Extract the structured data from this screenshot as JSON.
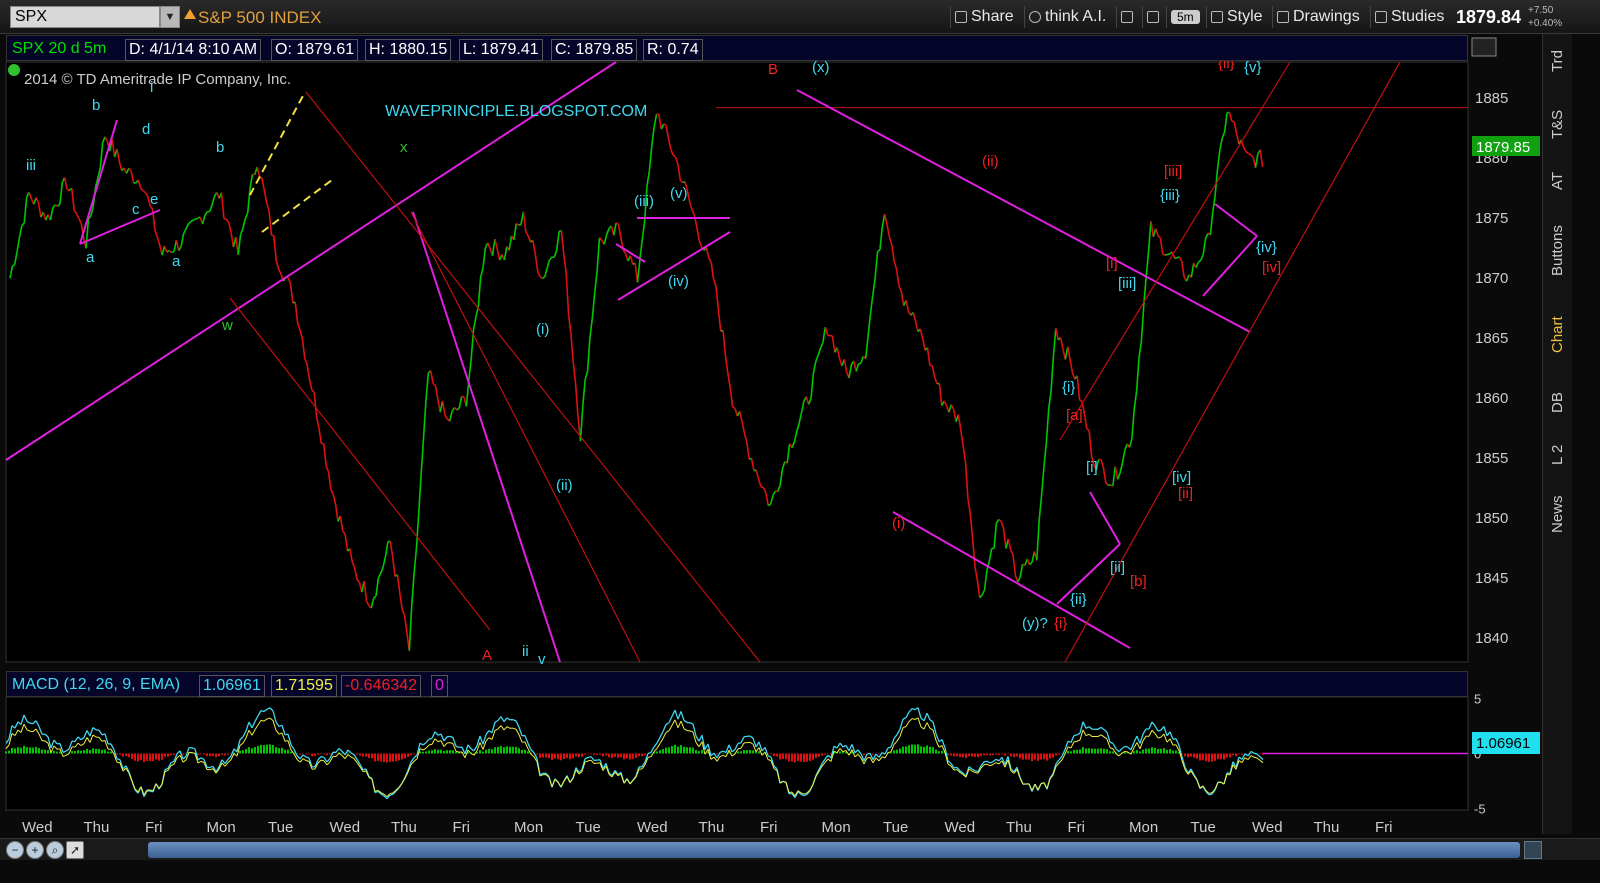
{
  "toolbar": {
    "symbol": "SPX",
    "index_name": "S&P 500 INDEX",
    "share": "Share",
    "think_ai": "think A.I.",
    "interval": "5m",
    "style": "Style",
    "drawings": "Drawings",
    "studies": "Studies",
    "last_price": "1879.84",
    "change_abs": "+7.50",
    "change_pct": "+0.40%"
  },
  "info_bar": {
    "title": "SPX 20 d 5m",
    "date": "D: 4/1/14 8:10 AM",
    "open": "O: 1879.61",
    "high": "H: 1880.15",
    "low": "L: 1879.41",
    "close": "C: 1879.85",
    "range": "R: 0.74"
  },
  "copyright": "2014 © TD Ameritrade IP Company, Inc.",
  "watermark": "WAVEPRINCIPLE.BLOGSPOT.COM",
  "macd_bar": {
    "label": "MACD (12, 26, 9, EMA)",
    "value": "1.06961",
    "avg": "1.71595",
    "diff": "-0.646342",
    "zero": "0",
    "current_badge": "1.06961"
  },
  "price_badge": "1879.85",
  "right_tabs": [
    "Trd",
    "T&S",
    "AT",
    "Buttons",
    "Chart",
    "DB",
    "L 2",
    "News"
  ],
  "active_tab": "Chart",
  "colors": {
    "up": "#00c800",
    "down": "#e01010",
    "magenta": "#e020e0",
    "cyan": "#40d8f0",
    "red_line": "#c01010"
  },
  "chart_data": {
    "type": "line",
    "title": "SPX 20 d 5m",
    "ylim": [
      1838,
      1888
    ],
    "y_ticks": [
      1840,
      1845,
      1850,
      1855,
      1860,
      1865,
      1870,
      1875,
      1880,
      1885
    ],
    "categories": [
      "Wed",
      "Thu",
      "Fri",
      "Mon",
      "Tue",
      "Wed",
      "Thu",
      "Fri",
      "Mon",
      "Tue",
      "Wed",
      "Thu",
      "Fri",
      "Mon",
      "Tue",
      "Wed",
      "Thu",
      "Fri",
      "Mon",
      "Tue",
      "Wed",
      "Thu",
      "Fri"
    ],
    "series": [
      {
        "values": [
          1870,
          1877,
          1875,
          1878,
          1873,
          1882,
          1879,
          1878,
          1872,
          1873,
          1875,
          1877,
          1872,
          1880,
          1872,
          1868,
          1860,
          1852,
          1846,
          1843,
          1848,
          1839,
          1862,
          1858,
          1860,
          1873,
          1872,
          1875,
          1870,
          1874,
          1857,
          1873,
          1874,
          1870,
          1884,
          1880,
          1875,
          1870,
          1860,
          1855,
          1851,
          1856,
          1860,
          1866,
          1862,
          1864,
          1876,
          1868,
          1865,
          1860,
          1858,
          1843,
          1850,
          1845,
          1847,
          1866,
          1862,
          1855,
          1853,
          1857,
          1874,
          1872,
          1870,
          1873,
          1884,
          1880,
          1879.85
        ]
      }
    ],
    "macd": {
      "ylim": [
        -5,
        5
      ],
      "y_ticks": [
        5,
        0,
        -5
      ]
    },
    "wave_labels": [
      "iii",
      "b",
      "i",
      "d",
      "c",
      "e",
      "a",
      "a",
      "b",
      "w",
      "x",
      "(iii)",
      "(v)",
      "(iv)",
      "(i)",
      "(ii)",
      "B",
      "(x)",
      "(ii)",
      "(i)",
      "{i}",
      "[a]",
      "[i]",
      "[ii]",
      "{ii}",
      "[b]",
      "(y)?",
      "{i}",
      "[iii]",
      "{iii}",
      "[iii]",
      "{iv}",
      "[iv]",
      "{ii}",
      "{v}",
      "[i]",
      "[ii]",
      "[iv]",
      "A",
      "ii",
      "v"
    ]
  },
  "x_axis_days": [
    "Wed",
    "Thu",
    "Fri",
    "Mon",
    "Tue",
    "Wed",
    "Thu",
    "Fri",
    "Mon",
    "Tue",
    "Wed",
    "Thu",
    "Fri",
    "Mon",
    "Tue",
    "Wed",
    "Thu",
    "Fri",
    "Mon",
    "Tue",
    "Wed",
    "Thu",
    "Fri"
  ]
}
